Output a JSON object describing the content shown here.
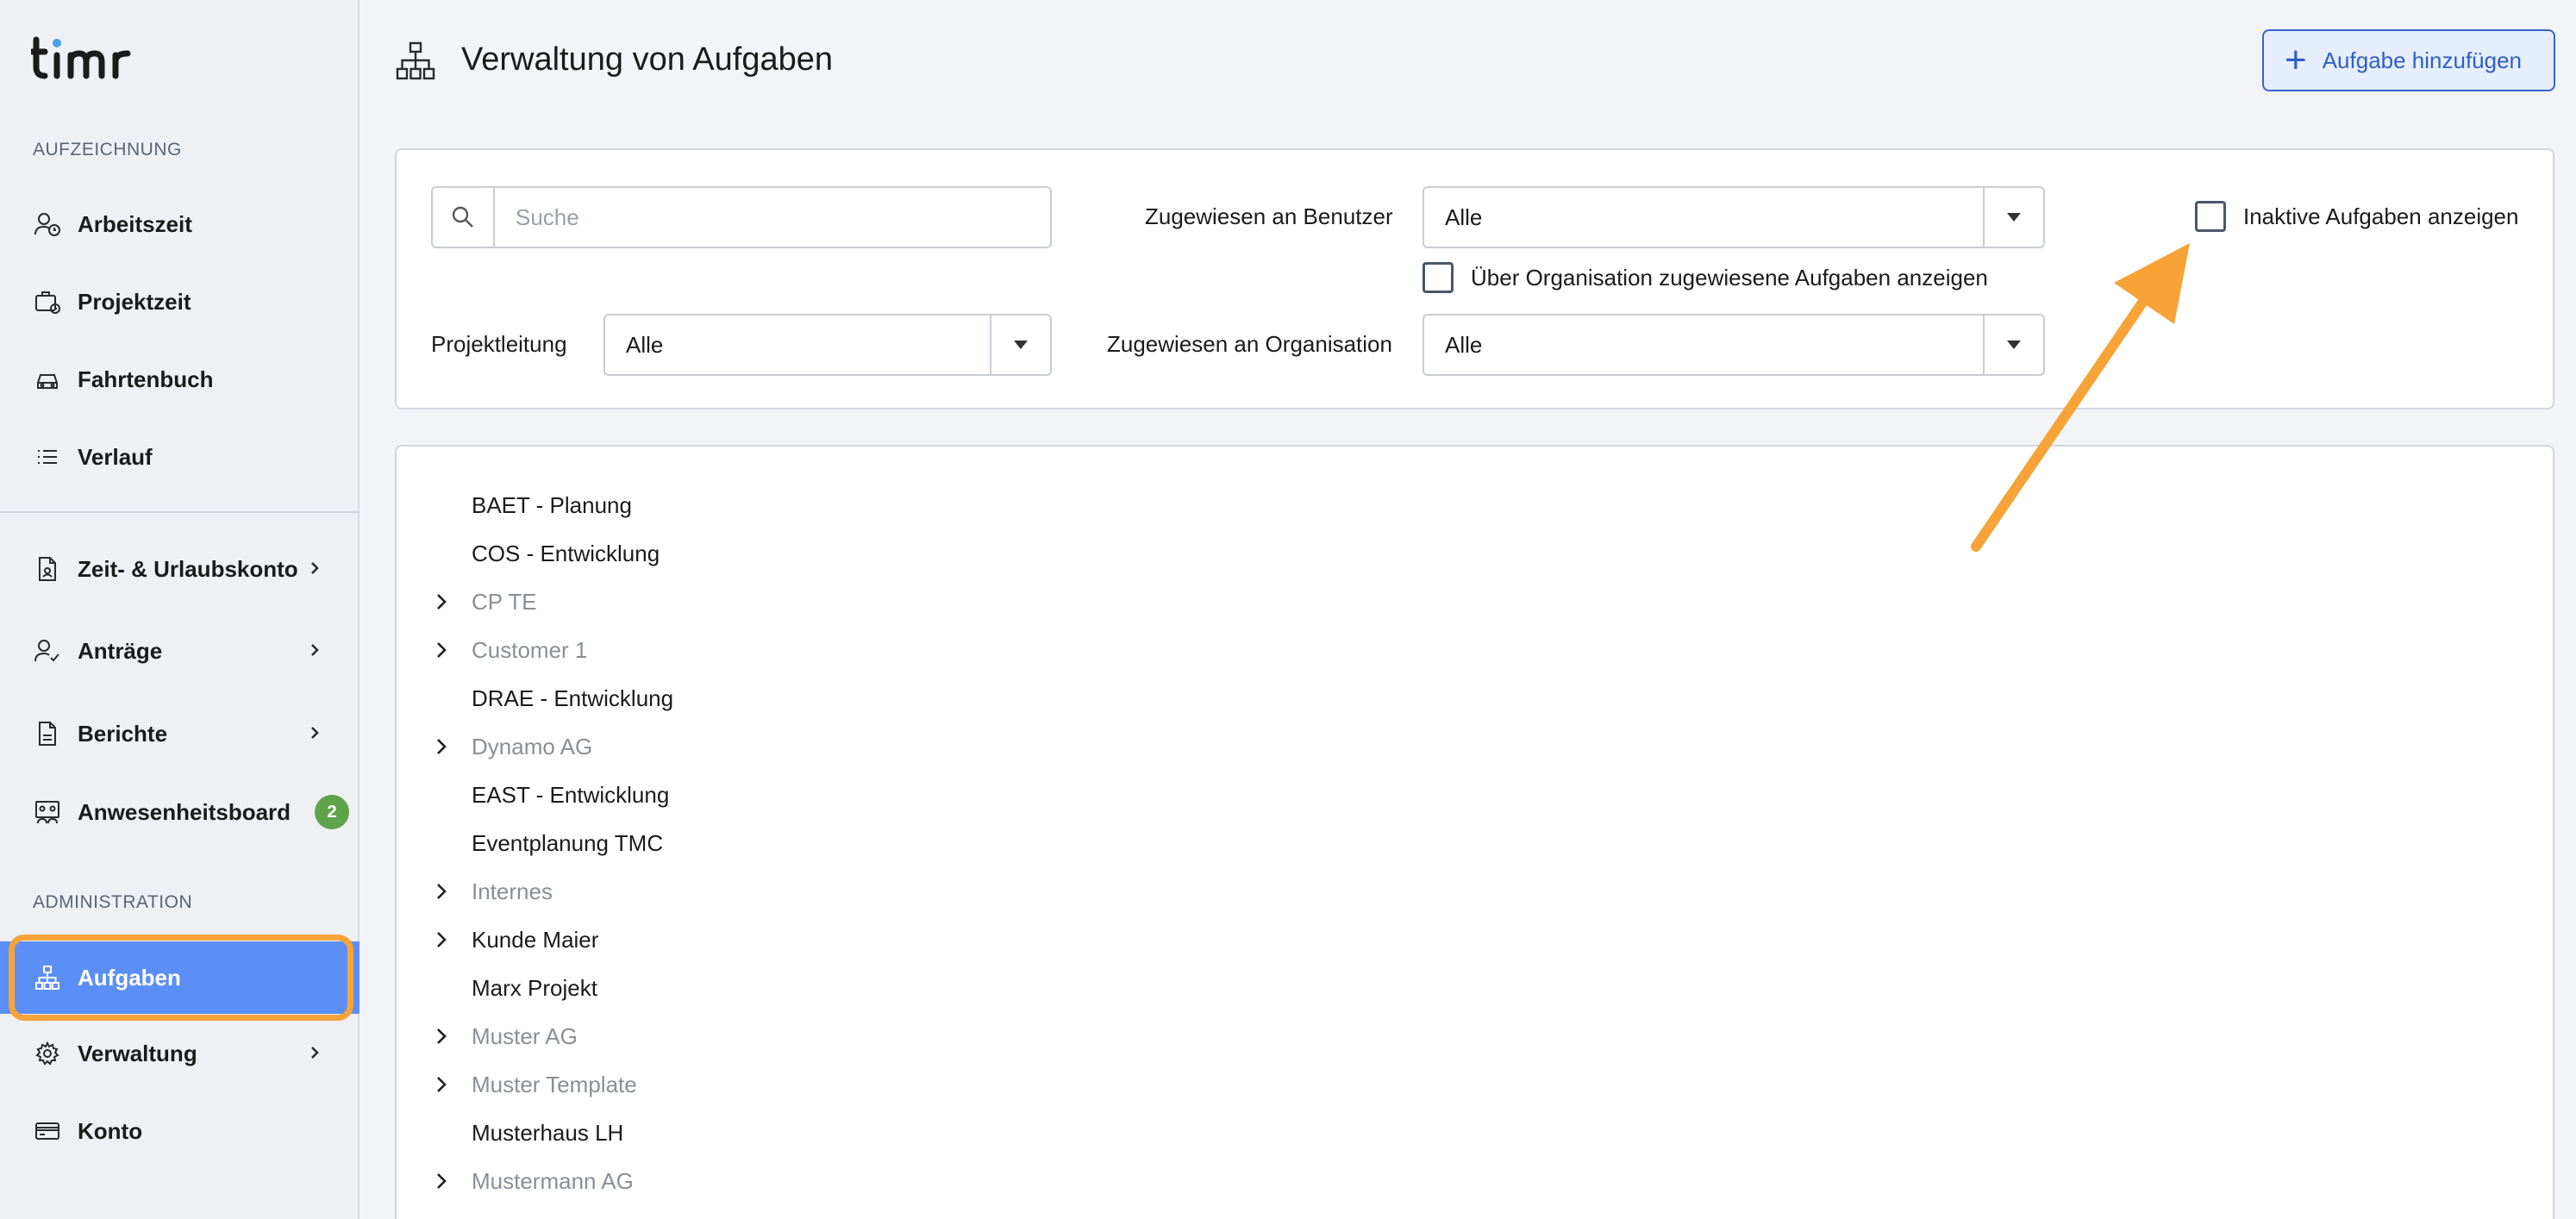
{
  "app": {
    "logo_text": "timr"
  },
  "sidebar": {
    "section_recording": "AUFZEICHNUNG",
    "section_admin": "ADMINISTRATION",
    "items": [
      {
        "label": "Arbeitszeit",
        "icon": "user-clock-icon"
      },
      {
        "label": "Projektzeit",
        "icon": "briefcase-clock-icon"
      },
      {
        "label": "Fahrtenbuch",
        "icon": "car-icon"
      },
      {
        "label": "Verlauf",
        "icon": "list-icon"
      },
      {
        "label": "Zeit- & Urlaubskonto",
        "icon": "document-icon",
        "has_submenu": true
      },
      {
        "label": "Anträge",
        "icon": "user-check-icon",
        "has_submenu": true
      },
      {
        "label": "Berichte",
        "icon": "report-icon",
        "has_submenu": true
      },
      {
        "label": "Anwesenheitsboard",
        "icon": "presence-board-icon",
        "badge": "2"
      },
      {
        "label": "Aufgaben",
        "icon": "hierarchy-icon",
        "active": true
      },
      {
        "label": "Verwaltung",
        "icon": "gear-icon",
        "has_submenu": true
      },
      {
        "label": "Konto",
        "icon": "credit-card-icon"
      }
    ]
  },
  "header": {
    "title": "Verwaltung von Aufgaben",
    "add_button": "Aufgabe hinzufügen"
  },
  "filters": {
    "search_placeholder": "Suche",
    "assigned_user_label": "Zugewiesen an Benutzer",
    "assigned_user_value": "Alle",
    "org_tasks_checkbox_label": "Über Organisation zugewiesene Aufgaben anzeigen",
    "inactive_checkbox_label": "Inaktive Aufgaben anzeigen",
    "project_lead_label": "Projektleitung",
    "project_lead_value": "Alle",
    "assigned_org_label": "Zugewiesen an Organisation",
    "assigned_org_value": "Alle"
  },
  "tree": [
    {
      "label": "BAET - Planung",
      "expandable": false,
      "inactive": false
    },
    {
      "label": "COS - Entwicklung",
      "expandable": false,
      "inactive": false
    },
    {
      "label": "CP TE",
      "expandable": true,
      "inactive": true
    },
    {
      "label": "Customer 1",
      "expandable": true,
      "inactive": true
    },
    {
      "label": "DRAE - Entwicklung",
      "expandable": false,
      "inactive": false
    },
    {
      "label": "Dynamo AG",
      "expandable": true,
      "inactive": true
    },
    {
      "label": "EAST - Entwicklung",
      "expandable": false,
      "inactive": false
    },
    {
      "label": "Eventplanung TMC",
      "expandable": false,
      "inactive": false
    },
    {
      "label": "Internes",
      "expandable": true,
      "inactive": true
    },
    {
      "label": "Kunde Maier",
      "expandable": true,
      "inactive": false
    },
    {
      "label": "Marx Projekt",
      "expandable": false,
      "inactive": false
    },
    {
      "label": "Muster AG",
      "expandable": true,
      "inactive": true
    },
    {
      "label": "Muster Template",
      "expandable": true,
      "inactive": true
    },
    {
      "label": "Musterhaus LH",
      "expandable": false,
      "inactive": false
    },
    {
      "label": "Mustermann AG",
      "expandable": true,
      "inactive": true
    }
  ],
  "colors": {
    "accent": "#5b8ff5",
    "highlight": "#f7a338",
    "badge": "#5fa34a",
    "inactive_text": "#8a8f96"
  }
}
